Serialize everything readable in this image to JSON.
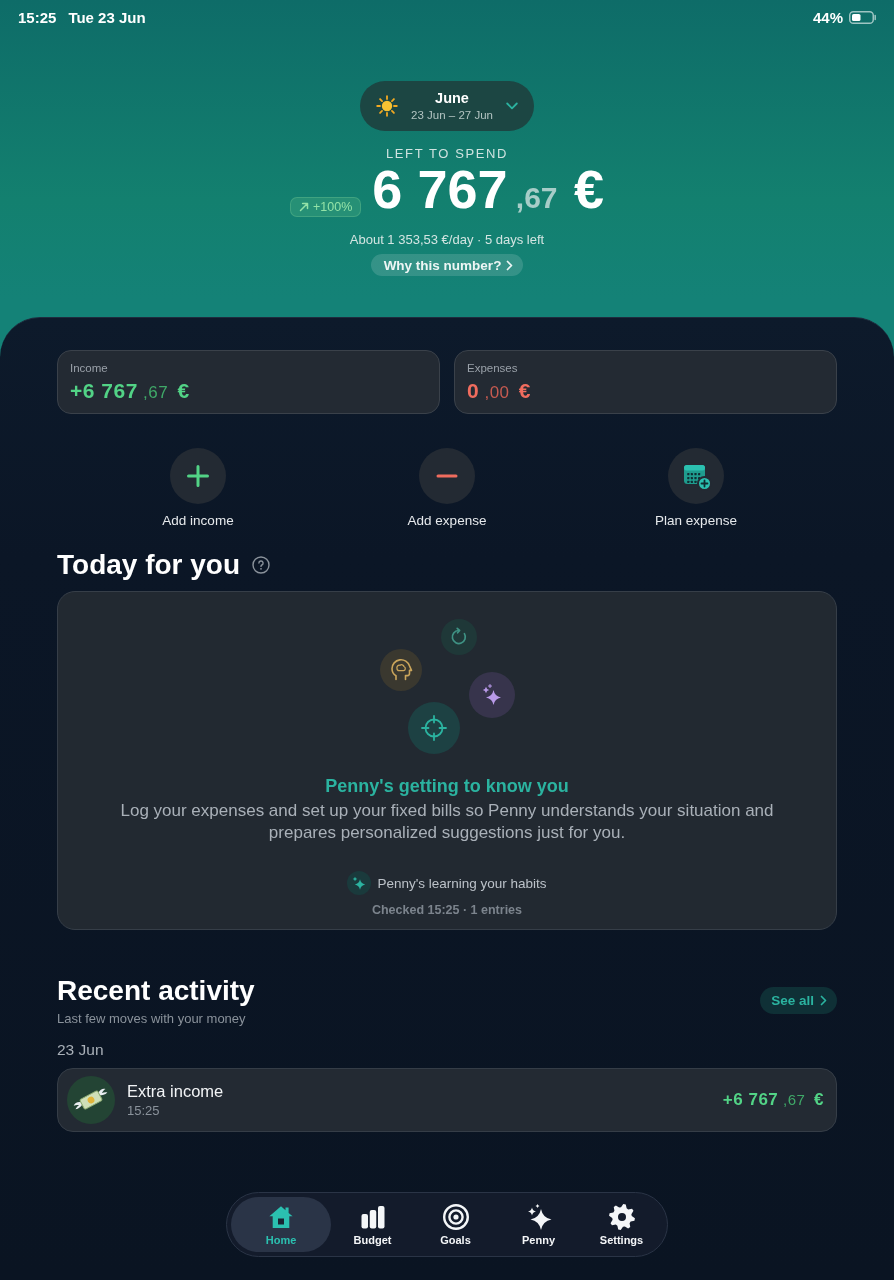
{
  "status_bar": {
    "time": "15:25",
    "date": "Tue 23 Jun",
    "battery": "44%"
  },
  "period_selector": {
    "month": "June",
    "range": "23 Jun – 27 Jun"
  },
  "left_to_spend": {
    "label": "LEFT TO SPEND",
    "change": "+100%",
    "amount": {
      "integer": "6 767",
      "decimal": ",67",
      "currency": "€"
    },
    "daily": "About 1 353,53 €/day · 5 days left",
    "why_link": "Why this number?"
  },
  "summary_cards": [
    {
      "kind": "income",
      "label": "Income",
      "amount": {
        "integer": "+6 767",
        "decimal": ",67",
        "currency": "€"
      }
    },
    {
      "kind": "expense",
      "label": "Expenses",
      "amount": {
        "integer": "0",
        "decimal": ",00",
        "currency": "€"
      }
    }
  ],
  "quick_actions": [
    {
      "kind": "income",
      "label": "Add income"
    },
    {
      "kind": "expense",
      "label": "Add expense"
    },
    {
      "kind": "plan",
      "label": "Plan expense"
    }
  ],
  "today_for_you": {
    "title": "Today for you",
    "heading": "Penny's getting to know you",
    "message": "Log your expenses and set up your fixed bills so Penny understands your situation and prepares personalized suggestions just for you.",
    "status": "Penny's learning your habits",
    "checked": "Checked 15:25 · 1 entries"
  },
  "recent_activity": {
    "title": "Recent activity",
    "subtitle": "Last few moves with your money",
    "see_all": "See all",
    "groups": [
      {
        "date": "23 Jun",
        "entries": [
          {
            "kind": "income",
            "title": "Extra income",
            "time": "15:25",
            "amount": {
              "integer": "+6 767",
              "decimal": ",67",
              "currency": "€"
            }
          }
        ]
      }
    ]
  },
  "tab_bar": [
    {
      "label": "Home",
      "selected": true
    },
    {
      "label": "Budget",
      "selected": false
    },
    {
      "label": "Goals",
      "selected": false
    },
    {
      "label": "Penny",
      "selected": false
    },
    {
      "label": "Settings",
      "selected": false
    }
  ]
}
